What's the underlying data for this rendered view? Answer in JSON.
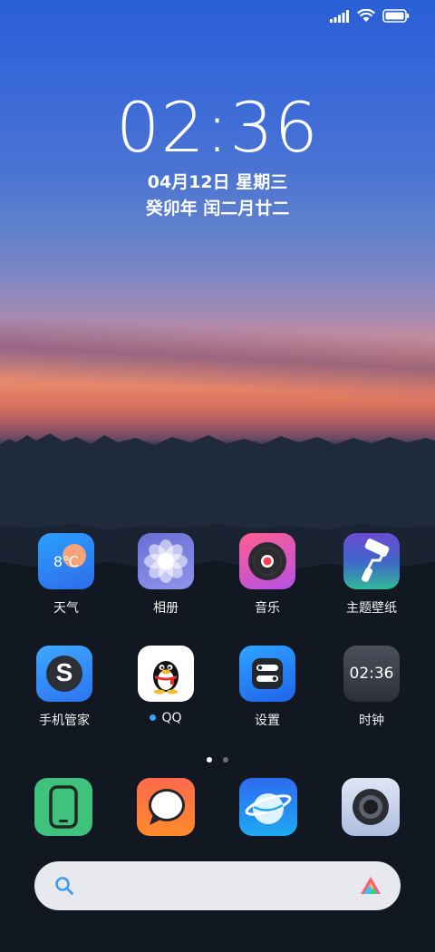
{
  "status_bar": {
    "signal_icon": "cellular-signal-icon",
    "wifi_icon": "wifi-icon",
    "battery_icon": "battery-icon"
  },
  "lockscreen": {
    "time": "02:36",
    "date": "04月12日 星期三",
    "lunar_date": "癸卯年 闰二月廿二"
  },
  "apps_row1": [
    {
      "label": "天气",
      "icon": "weather-icon",
      "temperature": "8℃"
    },
    {
      "label": "相册",
      "icon": "gallery-icon"
    },
    {
      "label": "音乐",
      "icon": "music-icon"
    },
    {
      "label": "主题壁纸",
      "icon": "themes-icon"
    }
  ],
  "apps_row2": [
    {
      "label": "手机管家",
      "icon": "security-icon",
      "glyph": "S"
    },
    {
      "label": "QQ",
      "icon": "qq-penguin-icon",
      "has_update_dot": true
    },
    {
      "label": "设置",
      "icon": "settings-icon"
    },
    {
      "label": "时钟",
      "icon": "clock-icon",
      "time": "02:36"
    }
  ],
  "pager": {
    "pages": 2,
    "current": 1
  },
  "dock": [
    {
      "icon": "phone-icon"
    },
    {
      "icon": "messages-icon"
    },
    {
      "icon": "browser-icon"
    },
    {
      "icon": "camera-icon"
    }
  ],
  "search_bar": {
    "placeholder": "",
    "search_icon": "search-icon",
    "assistant_icon": "assistant-icon"
  },
  "colors": {
    "accent_blue": "#36a2ff",
    "search_bg": "#e7e9ee"
  }
}
